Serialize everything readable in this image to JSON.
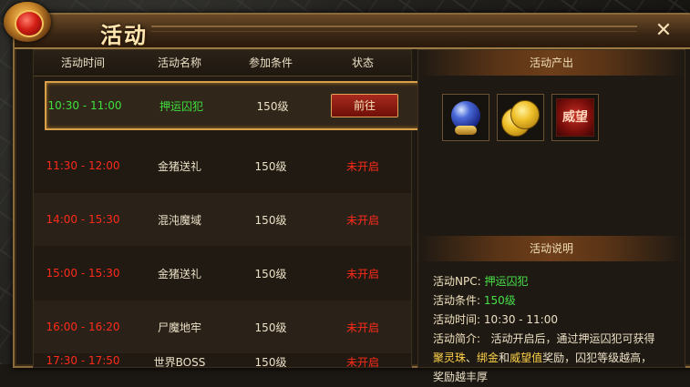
{
  "window": {
    "title": "活动",
    "close_glyph": "✕"
  },
  "table": {
    "headers": [
      "活动时间",
      "活动名称",
      "参加条件",
      "状态"
    ],
    "rows": [
      {
        "time": "10:30 - 11:00",
        "name": "押运囚犯",
        "level": "150级",
        "status": "前往",
        "state": "active"
      },
      {
        "time": "11:30 - 12:00",
        "name": "金猪送礼",
        "level": "150级",
        "status": "未开启",
        "state": "closed"
      },
      {
        "time": "14:00 - 15:30",
        "name": "混沌魔域",
        "level": "150级",
        "status": "未开启",
        "state": "closed"
      },
      {
        "time": "15:00 - 15:30",
        "name": "金猪送礼",
        "level": "150级",
        "status": "未开启",
        "state": "closed"
      },
      {
        "time": "16:00 - 16:20",
        "name": "尸魔地牢",
        "level": "150级",
        "status": "未开启",
        "state": "closed"
      },
      {
        "time": "17:30 - 17:50",
        "name": "世界BOSS",
        "level": "150级",
        "status": "未开启",
        "state": "closed"
      }
    ]
  },
  "rewards": {
    "title": "活动产出",
    "items": [
      {
        "icon": "spirit-orb-icon"
      },
      {
        "icon": "gold-coins-icon"
      },
      {
        "icon": "prestige-icon",
        "label": "威望"
      }
    ]
  },
  "description": {
    "title": "活动说明",
    "npc_label": "活动NPC:",
    "npc_value": "押运囚犯",
    "cond_label": "活动条件:",
    "cond_value": "150级",
    "time_label": "活动时间:",
    "time_value": "10:30 - 11:00",
    "intro_label": "活动简介:",
    "intro_text": "活动开启后，通过押运囚犯可获得",
    "intro_r1": "聚灵珠",
    "intro_sep1": "、",
    "intro_r2": "绑金",
    "intro_and": "和",
    "intro_r3": "威望值",
    "intro_rest": "奖励，囚犯等级越高，",
    "intro_tail": "奖励越丰厚"
  },
  "colors": {
    "active_time": "#3ee03e",
    "closed": "#ff2a1a",
    "frame": "#d7a049"
  }
}
